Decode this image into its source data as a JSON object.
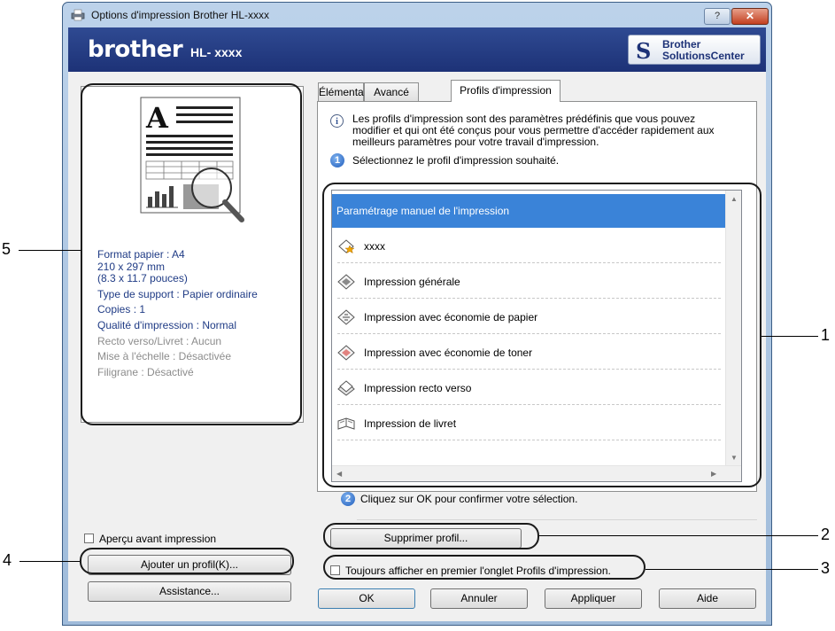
{
  "window": {
    "title": "Options d'impression Brother HL-xxxx",
    "help_label": "?",
    "close_label": "✕"
  },
  "brand": {
    "logo": "brother",
    "model": "HL- xxxx",
    "solutions_line1": "Brother",
    "solutions_line2": "SolutionsCenter"
  },
  "preview": {
    "settings": [
      {
        "text": "Format papier : A4",
        "active": true
      },
      {
        "text": "210 x 297 mm",
        "active": true
      },
      {
        "text": "(8.3 x 11.7 pouces)",
        "active": true
      },
      {
        "text": "Type de support : Papier ordinaire",
        "active": true
      },
      {
        "text": "Copies : 1",
        "active": true
      },
      {
        "text": "Qualité d'impression : Normal",
        "active": true
      },
      {
        "text": "Recto verso/Livret : Aucun",
        "active": false
      },
      {
        "text": "Mise à l'échelle : Désactivée",
        "active": false
      },
      {
        "text": "Filigrane : Désactivé",
        "active": false
      }
    ]
  },
  "left_controls": {
    "print_preview_label": "Aperçu avant impression",
    "add_profile_label": "Ajouter un profil(K)...",
    "assistance_label": "Assistance..."
  },
  "tabs": [
    {
      "label": "Élémentaire",
      "active": false
    },
    {
      "label": "Avancé",
      "active": false
    },
    {
      "label": "Profils d'impression",
      "active": true
    }
  ],
  "profiles_tab": {
    "info_line1": "Les profils d'impression sont des paramètres prédéfinis que vous pouvez",
    "info_line2": "modifier et qui ont été conçus pour vous permettre d'accéder rapidement aux",
    "info_line3": "meilleurs paramètres pour votre travail d'impression.",
    "step1_number": "1",
    "step1_text": "Sélectionnez le profil d'impression souhaité.",
    "profiles": [
      {
        "label": "Paramétrage manuel de l'impression",
        "icon": "none",
        "selected": true
      },
      {
        "label": "xxxx",
        "icon": "custom-profile-star-icon",
        "selected": false
      },
      {
        "label": "Impression générale",
        "icon": "general-print-icon",
        "selected": false
      },
      {
        "label": "Impression avec économie de papier",
        "icon": "paper-save-icon",
        "selected": false
      },
      {
        "label": "Impression avec économie de toner",
        "icon": "toner-save-icon",
        "selected": false
      },
      {
        "label": "Impression recto verso",
        "icon": "duplex-print-icon",
        "selected": false
      },
      {
        "label": "Impression de livret",
        "icon": "booklet-print-icon",
        "selected": false
      }
    ],
    "step2_number": "2",
    "step2_text": "Cliquez sur OK pour confirmer votre sélection.",
    "delete_profile_label": "Supprimer profil...",
    "always_show_label": "Toujours afficher en premier l'onglet Profils d'impression."
  },
  "footer": {
    "ok_label": "OK",
    "cancel_label": "Annuler",
    "apply_label": "Appliquer",
    "help_label": "Aide"
  },
  "callouts": {
    "c1": "1",
    "c2": "2",
    "c3": "3",
    "c4": "4",
    "c5": "5"
  },
  "colors": {
    "brand_blue": "#1d3277",
    "selection_blue": "#3a83d8",
    "settings_text": "#1f3b85",
    "inactive_text": "#8c8c8c"
  }
}
